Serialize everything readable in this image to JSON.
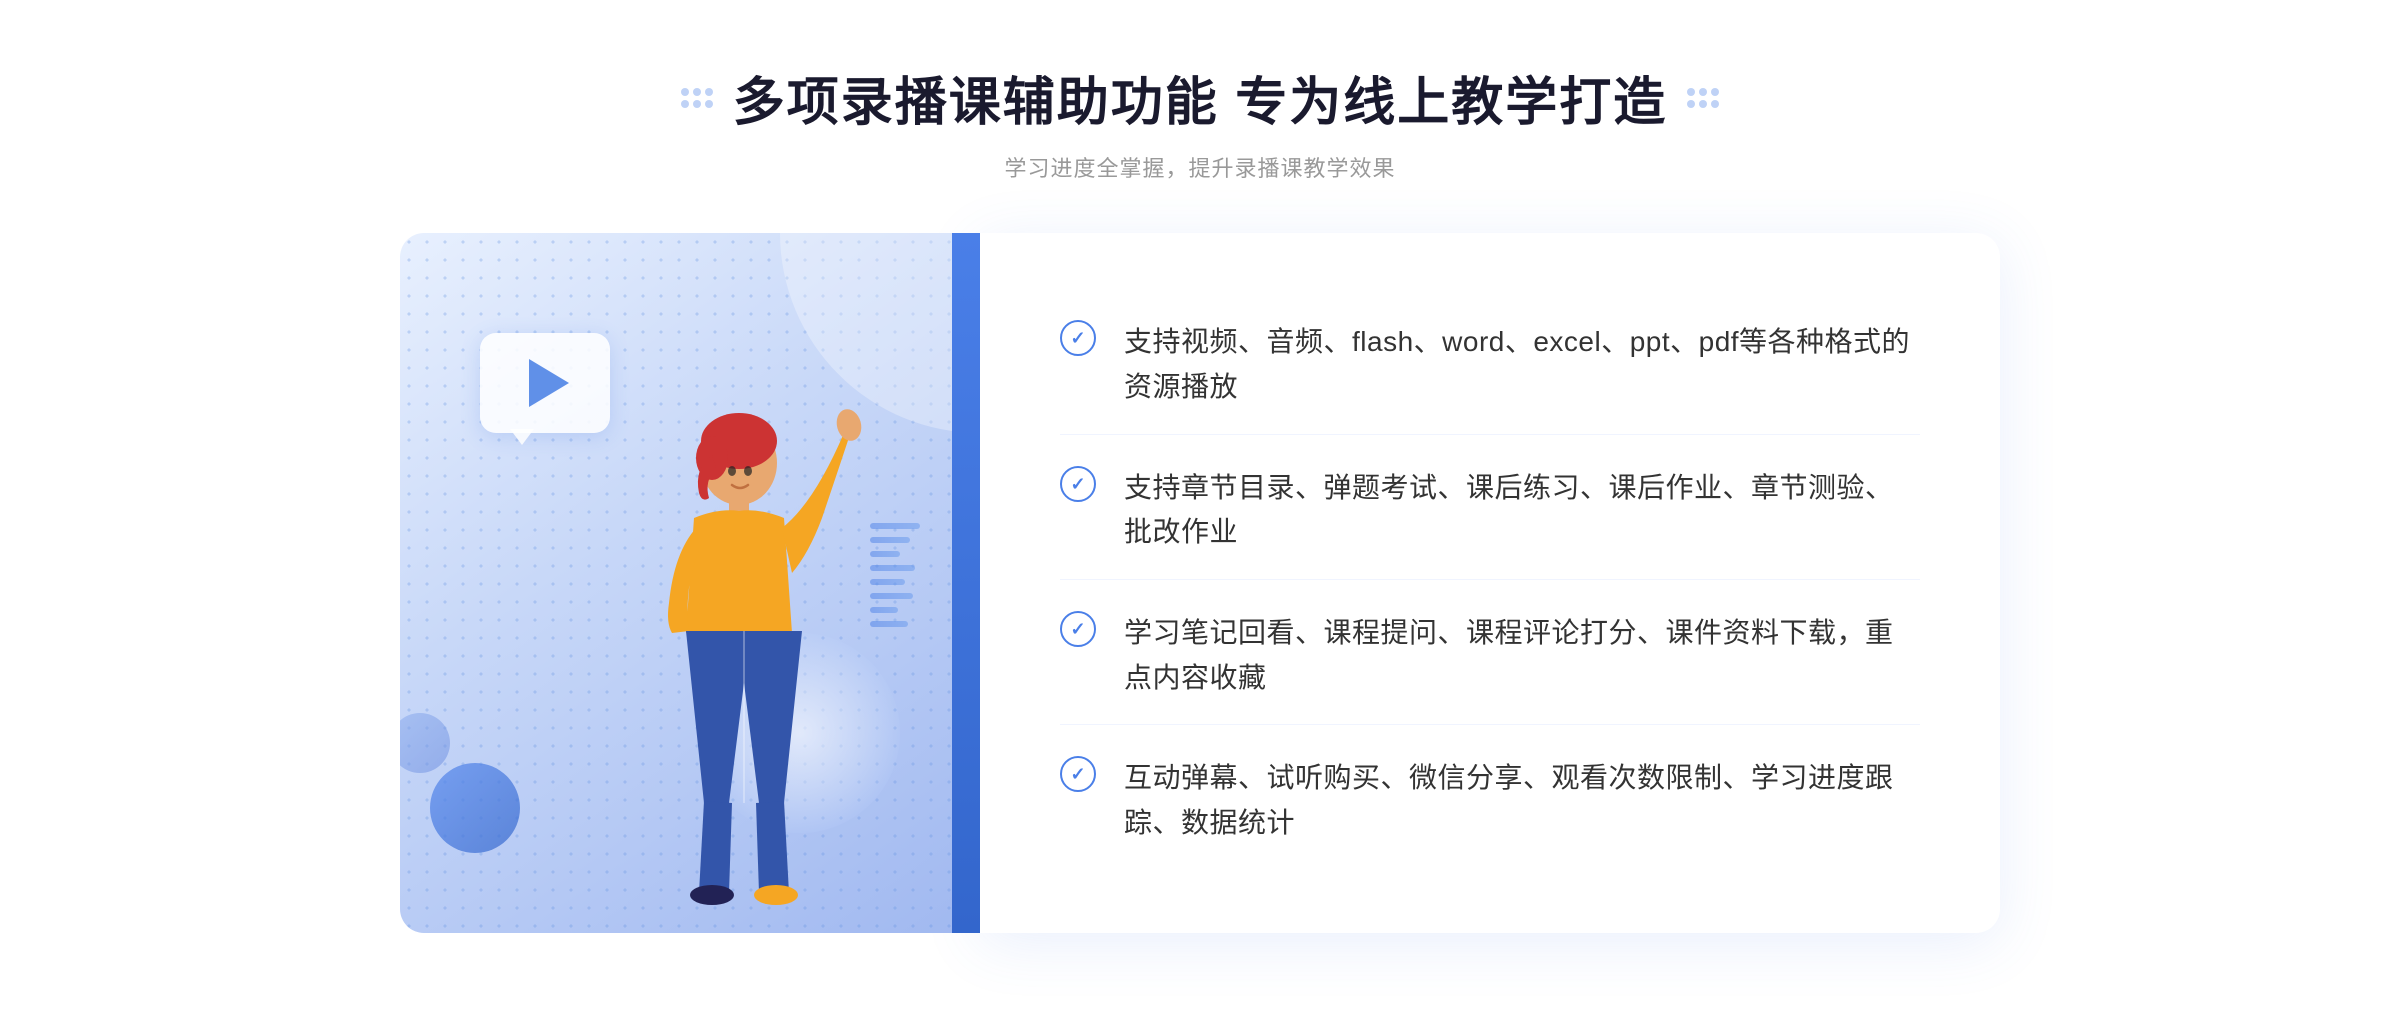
{
  "header": {
    "title": "多项录播课辅助功能 专为线上教学打造",
    "subtitle": "学习进度全掌握，提升录播课教学效果"
  },
  "features": [
    {
      "id": "feature-1",
      "text": "支持视频、音频、flash、word、excel、ppt、pdf等各种格式的资源播放"
    },
    {
      "id": "feature-2",
      "text": "支持章节目录、弹题考试、课后练习、课后作业、章节测验、批改作业"
    },
    {
      "id": "feature-3",
      "text": "学习笔记回看、课程提问、课程评论打分、课件资料下载，重点内容收藏"
    },
    {
      "id": "feature-4",
      "text": "互动弹幕、试听购买、微信分享、观看次数限制、学习进度跟踪、数据统计"
    }
  ],
  "decorations": {
    "header_dots_left": "decorative-dots",
    "header_dots_right": "decorative-dots",
    "chevron_symbol": "»",
    "play_icon": "▶"
  }
}
